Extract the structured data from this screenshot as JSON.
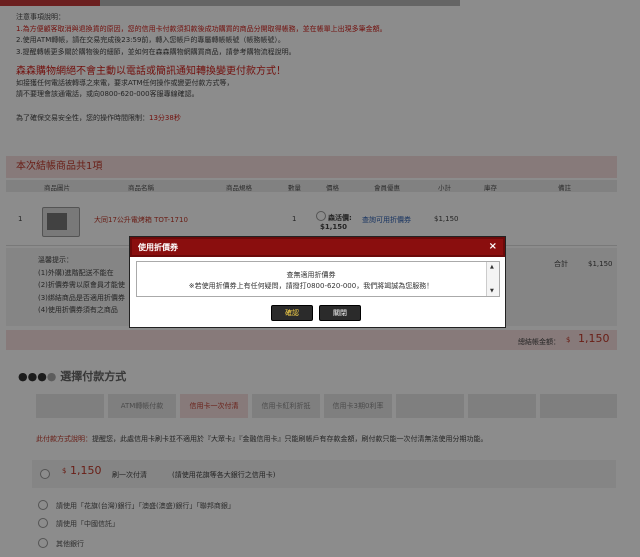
{
  "notice": {
    "heading": "注意事項說明：",
    "line1": "1.為方便顧客取消與退換貨的原因，您的信用卡付款須扣款後成功購買的商品分開取得帳務，並在帳單上出現多筆金額。",
    "line2": "2.使用ATM轉帳，請在交易完成後23:59前，轉入您帳戶的專屬轉帳帳號（帳務帳號）。",
    "line3": "3.提醒轉帳更多關於購物後的細節，並如何在森森購物網購買商品，請參考購物流程說明。",
    "warning": "森森購物網絕不會主動以電話或簡訊通知轉換變更付款方式！",
    "warn1": "如接獲任何電話被轉導之來電，要求ATM任何操作或變更付款方式等，",
    "warn2": "請不要理會該通電話，或向0800-620-000客服專線確認。",
    "timer_label": "為了確保交易安全性，您的操作時間限制：",
    "timer_value": "13分38秒"
  },
  "cart": {
    "title": "本次結帳商品",
    "count": "共1項",
    "columns": [
      "商品圖片",
      "商品名稱",
      "商品規格",
      "數量",
      "價格",
      "會員優惠",
      "小計",
      "庫存",
      "備註"
    ],
    "row": {
      "index": "1",
      "name": "大同17公升電烤箱 TOT-1710",
      "qty": "1",
      "price_label": "森活價:",
      "price": "$1,150",
      "discount_link": "查詢可用折價券",
      "subtotal": "$1,150"
    },
    "tips_title": "溫馨提示：",
    "tips": [
      "(1)外購)進階配送不能在",
      "(2)折價券需以原會員才能使",
      "(3)綁結商品是否適用折價券",
      "(4)使用折價券須有之商品"
    ],
    "sum_label": "合計",
    "sum_value": "$1,150",
    "total_label": "總結帳金額：",
    "total_currency": "$",
    "total_value": "1,150"
  },
  "payment": {
    "title": "選擇付款方式",
    "tabs": [
      "",
      "ATM轉帳付款",
      "信用卡一次付清",
      "信用卡紅利折抵",
      "信用卡3期0利率",
      "",
      "",
      ""
    ],
    "info_label": "此付款方式說明：",
    "info_text": "提醒您，此處信用卡刷卡並不適用於『大眾卡』『金融信用卡』只能刷帳戶有存款金額，刷付款只能一次付清無法使用分期功能。",
    "amount_currency": "$",
    "amount": "1,150",
    "pay_option": "刷一次付清",
    "pay_note": "(請使用花旗等各大銀行之信用卡)",
    "options": [
      "請使用「花旗(台灣)銀行」「澳盛(澳盛)銀行」「聯邦商銀」",
      "請使用「中國信託」",
      "其他銀行"
    ]
  },
  "modal": {
    "title": "使用折價券",
    "close": "×",
    "message1": "查無適用折價券",
    "message2": "※若使用折價券上有任何疑問，請撥打0800-620-000，我們將竭誠為您服務！",
    "confirm": "確認",
    "cancel": "關閉"
  },
  "colors": {
    "accent": "#c0392b",
    "modal_header": "#8a0e0e",
    "pink_band": "#f6dede"
  }
}
